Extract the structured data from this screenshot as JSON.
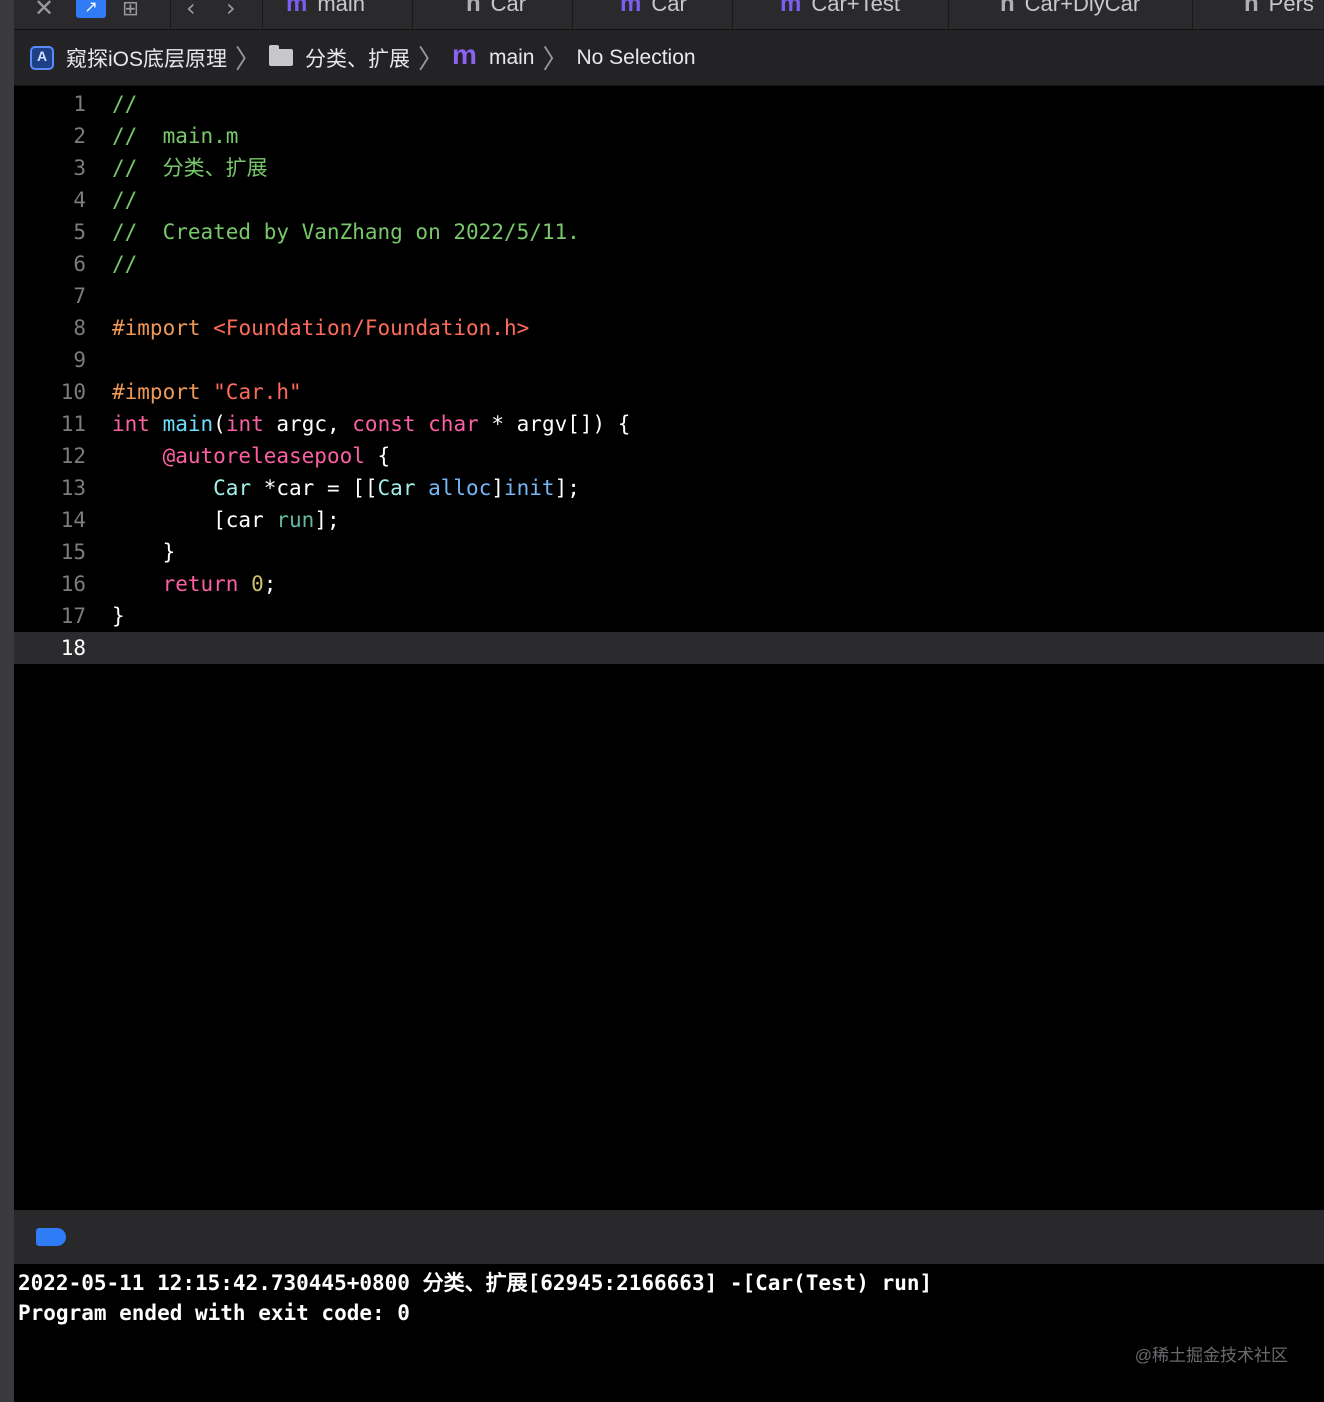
{
  "tabs": [
    {
      "kind": "m",
      "label": "main"
    },
    {
      "kind": "h",
      "label": "Car"
    },
    {
      "kind": "m",
      "label": "Car"
    },
    {
      "kind": "m",
      "label": "Car+Test"
    },
    {
      "kind": "h",
      "label": "Car+DiyCar"
    },
    {
      "kind": "h",
      "label": "Pers"
    }
  ],
  "breadcrumb": {
    "project": "窥探iOS底层原理",
    "group": "分类、扩展",
    "file_icon": "m",
    "file": "main",
    "symbol": "No Selection"
  },
  "editor": {
    "current_line": 18,
    "lines": [
      {
        "n": "1",
        "t": [
          [
            "c-comment",
            "//"
          ]
        ]
      },
      {
        "n": "2",
        "t": [
          [
            "c-comment",
            "//  main.m"
          ]
        ]
      },
      {
        "n": "3",
        "t": [
          [
            "c-comment",
            "//  分类、扩展"
          ]
        ]
      },
      {
        "n": "4",
        "t": [
          [
            "c-comment",
            "//"
          ]
        ]
      },
      {
        "n": "5",
        "t": [
          [
            "c-comment",
            "//  Created by VanZhang on 2022/5/11."
          ]
        ]
      },
      {
        "n": "6",
        "t": [
          [
            "c-comment",
            "//"
          ]
        ]
      },
      {
        "n": "7",
        "t": []
      },
      {
        "n": "8",
        "t": [
          [
            "c-pre",
            "#import "
          ],
          [
            "c-str",
            "<Foundation/Foundation.h>"
          ]
        ]
      },
      {
        "n": "9",
        "t": []
      },
      {
        "n": "10",
        "t": [
          [
            "c-pre",
            "#import "
          ],
          [
            "c-str",
            "\"Car.h\""
          ]
        ]
      },
      {
        "n": "11",
        "t": [
          [
            "c-kw",
            "int"
          ],
          [
            "",
            " "
          ],
          [
            "c-fn",
            "main"
          ],
          [
            "",
            "("
          ],
          [
            "c-kw",
            "int"
          ],
          [
            "",
            " argc, "
          ],
          [
            "c-kw",
            "const"
          ],
          [
            "",
            " "
          ],
          [
            "c-kw",
            "char"
          ],
          [
            "",
            " * argv[]) {"
          ]
        ]
      },
      {
        "n": "12",
        "t": [
          [
            "",
            "    "
          ],
          [
            "c-at",
            "@autoreleasepool"
          ],
          [
            "",
            " {"
          ]
        ]
      },
      {
        "n": "13",
        "t": [
          [
            "",
            "        "
          ],
          [
            "c-cls",
            "Car"
          ],
          [
            "",
            " *car = [["
          ],
          [
            "c-cls",
            "Car"
          ],
          [
            "",
            " "
          ],
          [
            "c-meth",
            "alloc"
          ],
          [
            "",
            "]"
          ],
          [
            "c-meth",
            "init"
          ],
          [
            "",
            "];"
          ]
        ]
      },
      {
        "n": "14",
        "t": [
          [
            "",
            "        [car "
          ],
          [
            "c-sel",
            "run"
          ],
          [
            "",
            "];"
          ]
        ]
      },
      {
        "n": "15",
        "t": [
          [
            "",
            "    }"
          ]
        ]
      },
      {
        "n": "16",
        "t": [
          [
            "",
            "    "
          ],
          [
            "c-kw",
            "return"
          ],
          [
            "",
            " "
          ],
          [
            "c-num",
            "0"
          ],
          [
            "",
            ";"
          ]
        ]
      },
      {
        "n": "17",
        "t": [
          [
            "",
            "}"
          ]
        ]
      },
      {
        "n": "18",
        "t": []
      }
    ]
  },
  "console": {
    "lines": [
      "2022-05-11 12:15:42.730445+0800 分类、扩展[62945:2166663] -[Car(Test) run]",
      "Program ended with exit code: 0"
    ]
  },
  "watermark": "@稀土掘金技术社区",
  "colors": {
    "accent": "#2f7cf6",
    "comment": "#77c96a",
    "keyword": "#fc5fa3",
    "string": "#ff6b5a",
    "preprocessor": "#f09855"
  }
}
